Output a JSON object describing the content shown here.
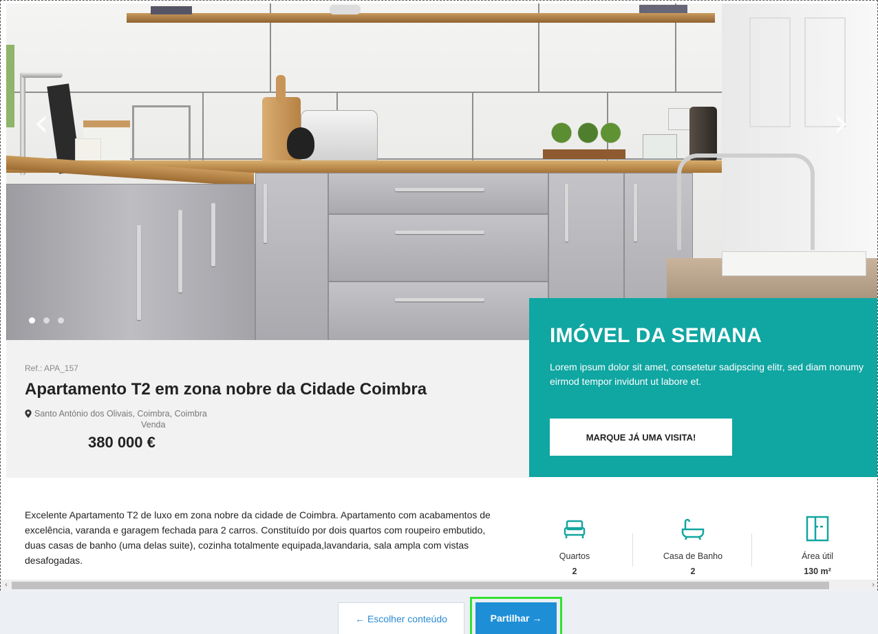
{
  "hero": {
    "prev_arrow": "‹",
    "next_arrow": "›",
    "slides_count": 3,
    "active_slide": 1
  },
  "listing": {
    "ref": "Ref.: APA_157",
    "title": "Apartamento T2 em zona nobre da Cidade Coimbra",
    "location": "Santo António dos Olivais, Coimbra, Coimbra",
    "type": "Venda",
    "price": "380 000 €",
    "description": "Excelente Apartamento T2 de luxo em zona nobre da cidade de Coimbra. Apartamento com acabamentos de excelência, varanda e garagem fechada para 2 carros. Constituído por dois quartos com roupeiro embutido, duas casas de banho (uma delas suite), cozinha totalmente equipada,lavandaria, sala ampla com vistas desafogadas."
  },
  "promo": {
    "title": "IMÓVEL DA SEMANA",
    "text": "Lorem ipsum dolor sit amet, consetetur sadipscing elitr, sed diam nonumy eirmod tempor invidunt ut labore et.",
    "button_label": "MARQUE JÁ UMA VISITA!"
  },
  "features": [
    {
      "icon": "bed-icon",
      "label": "Quartos",
      "value": "2"
    },
    {
      "icon": "bathtub-icon",
      "label": "Casa de Banho",
      "value": "2"
    },
    {
      "icon": "floorplan-icon",
      "label": "Área útil",
      "value": "130 m²"
    }
  ],
  "scrollbar": {
    "left_arrow": "‹",
    "right_arrow": "›"
  },
  "footer": {
    "back_label": "← Escolher conteúdo",
    "share_label": "Partilhar →"
  },
  "colors": {
    "teal": "#10a6a2",
    "blue": "#1e8fd6",
    "highlight": "#33e133"
  }
}
